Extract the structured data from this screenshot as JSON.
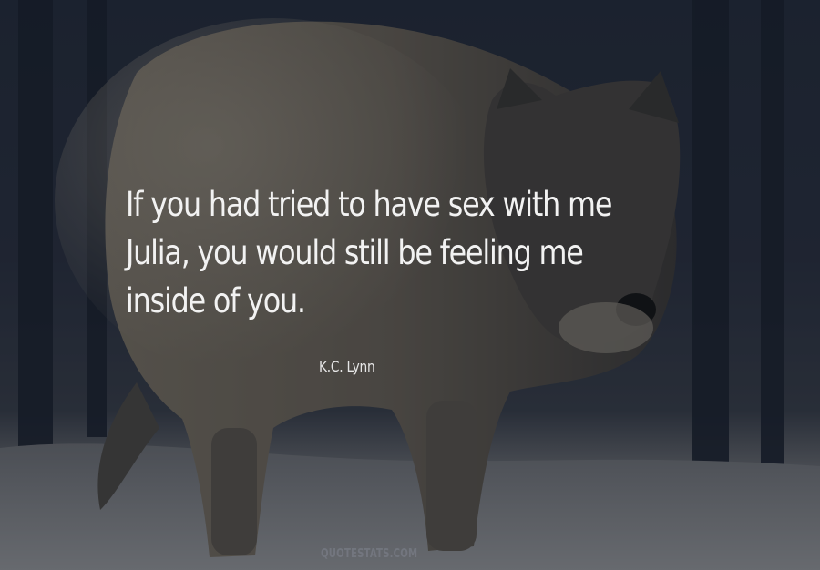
{
  "background": {
    "subject": "wolf-in-snow-photo",
    "colors": {
      "sky": "#262d3c",
      "snow": "#8c8d90",
      "fur_light": "#8a8070",
      "fur_dark": "#3c3a38",
      "text": "#f2f2f2"
    }
  },
  "quote": {
    "lines": [
      "If you had tried to have sex with me",
      "Julia, you would still be feeling me",
      "inside of you."
    ]
  },
  "author": "K.C. Lynn",
  "watermark": "QUOTESTATS.COM"
}
